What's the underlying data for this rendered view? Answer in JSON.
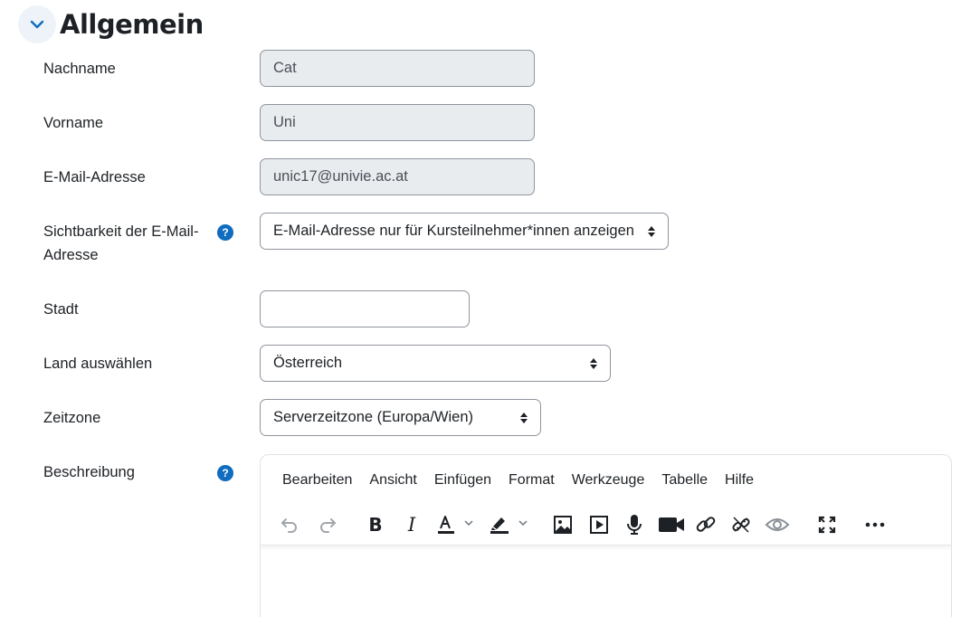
{
  "section": {
    "title": "Allgemein",
    "collapse_icon": "chevron-down-icon"
  },
  "fields": {
    "lastname": {
      "label": "Nachname",
      "value": "Cat"
    },
    "firstname": {
      "label": "Vorname",
      "value": "Uni"
    },
    "email": {
      "label": "E-Mail-Adresse",
      "value": "unic17@univie.ac.at"
    },
    "email_visibility": {
      "label_line1": "Sichtbarkeit der E-Mail-",
      "label_line2": "Adresse",
      "value": "E-Mail-Adresse nur für Kursteilnehmer*innen anzeigen",
      "help": "?"
    },
    "city": {
      "label": "Stadt",
      "value": ""
    },
    "country": {
      "label": "Land auswählen",
      "value": "Österreich"
    },
    "timezone": {
      "label": "Zeitzone",
      "value": "Serverzeitzone (Europa/Wien)"
    },
    "description": {
      "label": "Beschreibung",
      "help": "?"
    }
  },
  "editor": {
    "menu": [
      "Bearbeiten",
      "Ansicht",
      "Einfügen",
      "Format",
      "Werkzeuge",
      "Tabelle",
      "Hilfe"
    ],
    "toolbar_icons": [
      "undo-icon",
      "redo-icon",
      "bold-icon",
      "italic-icon",
      "text-color-icon",
      "highlight-icon",
      "image-icon",
      "media-icon",
      "microphone-icon",
      "video-camera-icon",
      "link-icon",
      "unlink-icon",
      "preview-eye-icon",
      "fullscreen-icon",
      "more-icon"
    ]
  },
  "colors": {
    "accent": "#0f6cbf",
    "readonly_bg": "#e9ecef",
    "border": "#8f959e",
    "text": "#1d2125"
  }
}
